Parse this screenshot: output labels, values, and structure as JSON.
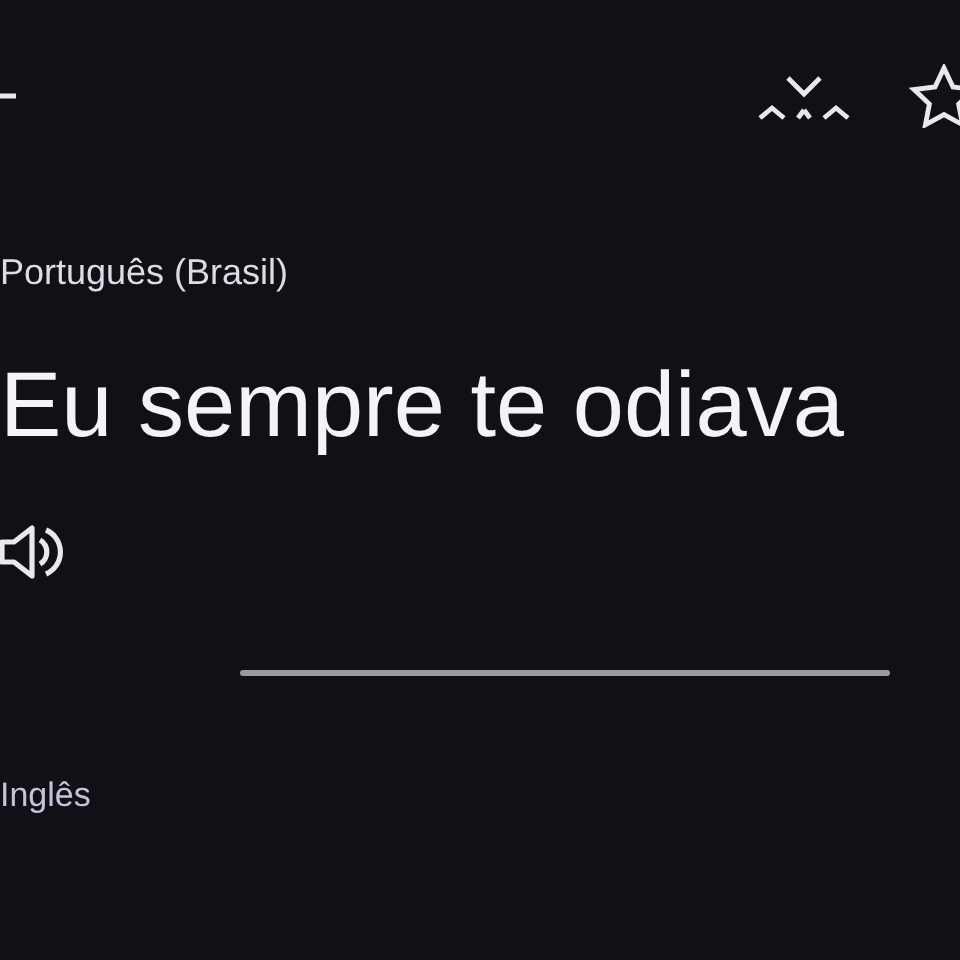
{
  "source": {
    "language": "Português (Brasil)",
    "text": "Eu sempre te odiava"
  },
  "target": {
    "language": "Inglês"
  }
}
